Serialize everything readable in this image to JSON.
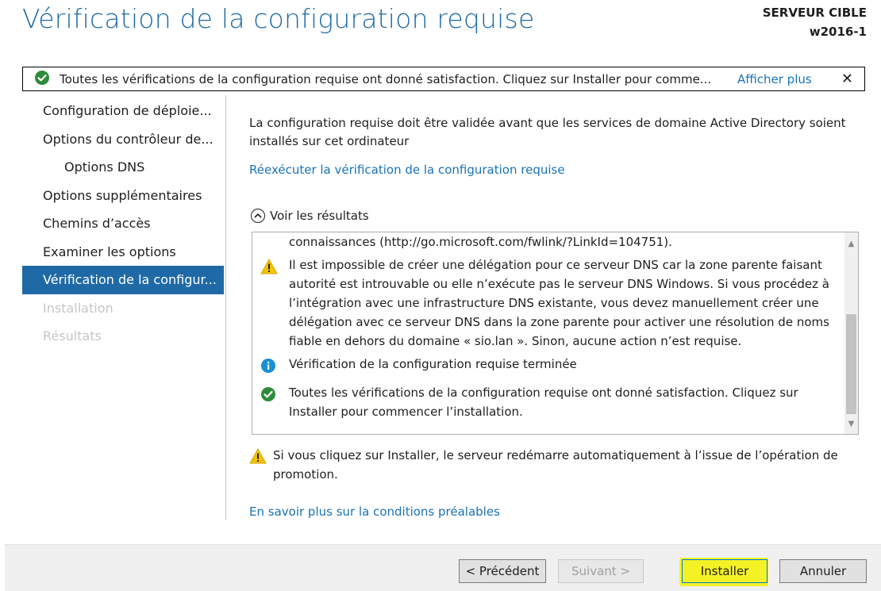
{
  "header": {
    "title": "Vérification de la configuration requise",
    "target_label": "SERVEUR CIBLE",
    "target_name": "w2016-1"
  },
  "banner": {
    "message": "Toutes les vérifications de la configuration requise ont donné satisfaction. Cliquez sur Installer pour comme...",
    "more_link": "Afficher plus",
    "close_glyph": "✕"
  },
  "sidebar": {
    "items": [
      {
        "label": "Configuration de déploie..."
      },
      {
        "label": "Options du contrôleur de..."
      },
      {
        "label": "Options DNS"
      },
      {
        "label": "Options supplémentaires"
      },
      {
        "label": "Chemins d’accès"
      },
      {
        "label": "Examiner les options"
      },
      {
        "label": "Vérification de la configur..."
      },
      {
        "label": "Installation"
      },
      {
        "label": "Résultats"
      }
    ]
  },
  "content": {
    "description": "La configuration requise doit être validée avant que les services de domaine Active Directory soient installés sur cet ordinateur",
    "rerun_link": "Réexécuter la vérification de la configuration requise",
    "results_toggle": "Voir les résultats",
    "results": [
      {
        "icon": "none",
        "text": "connaissances (http://go.microsoft.com/fwlink/?LinkId=104751)."
      },
      {
        "icon": "warning-icon",
        "text": "Il est impossible de créer une délégation pour ce serveur DNS car la zone parente faisant autorité est introuvable ou elle n’exécute pas le serveur DNS Windows. Si vous procédez à l’intégration avec une infrastructure DNS existante, vous devez manuellement créer une délégation avec ce serveur DNS dans la zone parente pour activer une résolution de noms fiable en dehors du domaine « sio.lan ». Sinon, aucune action n’est requise."
      },
      {
        "icon": "info-icon",
        "text": "Vérification de la configuration requise terminée"
      },
      {
        "icon": "check-icon",
        "text": "Toutes les vérifications de la configuration requise ont donné satisfaction. Cliquez sur Installer pour commencer l’installation."
      }
    ],
    "restart_warning": "Si vous cliquez sur Installer, le serveur redémarre automatiquement à l’issue de l’opération de promotion.",
    "learn_more_link": "En savoir plus sur la conditions préalables"
  },
  "footer": {
    "prev": "< Précédent",
    "next": "Suivant >",
    "install": "Installer",
    "cancel": "Annuler"
  },
  "colors": {
    "accent": "#1f6aa6",
    "link": "#1a73b8",
    "success": "#2e8b3a",
    "warning": "#f2c200",
    "info": "#1a8fd4",
    "highlight": "#f4f200"
  }
}
